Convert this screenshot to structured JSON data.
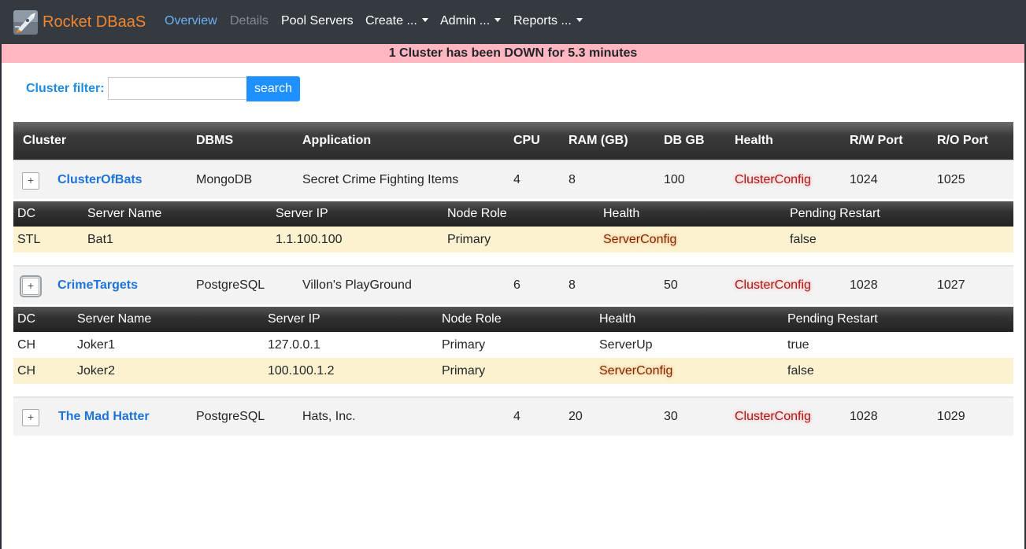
{
  "brand": {
    "name": "Rocket DBaaS",
    "logo_icon": "rocket-logo-icon"
  },
  "nav": {
    "overview": "Overview",
    "details": "Details",
    "pool_servers": "Pool Servers",
    "create": "Create ...",
    "admin": "Admin ...",
    "reports": "Reports ..."
  },
  "alert": {
    "text": "1 Cluster has been DOWN for 5.3 minutes"
  },
  "filter": {
    "label": "Cluster filter:",
    "value": "",
    "placeholder": "",
    "button": "search"
  },
  "table": {
    "headers": {
      "cluster": "Cluster",
      "dbms": "DBMS",
      "application": "Application",
      "cpu": "CPU",
      "ram": "RAM (GB)",
      "db_gb": "DB GB",
      "health": "Health",
      "rw_port": "R/W Port",
      "ro_port": "R/O Port"
    },
    "server_headers": {
      "dc": "DC",
      "server_name": "Server Name",
      "server_ip": "Server IP",
      "node_role": "Node Role",
      "health": "Health",
      "pending_restart": "Pending Restart"
    },
    "clusters": [
      {
        "expand": "+",
        "name": "ClusterOfBats",
        "dbms": "MongoDB",
        "application": "Secret Crime Fighting Items",
        "cpu": "4",
        "ram": "8",
        "db_gb": "100",
        "health": "ClusterConfig",
        "rw_port": "1024",
        "ro_port": "1025",
        "servers": [
          {
            "dc": "STL",
            "server_name": "Bat1",
            "server_ip": "1.1.100.100",
            "node_role": "Primary",
            "health": "ServerConfig",
            "pending_restart": "false"
          }
        ]
      },
      {
        "expand": "+",
        "name": "CrimeTargets",
        "dbms": "PostgreSQL",
        "application": "Villon's PlayGround",
        "cpu": "6",
        "ram": "8",
        "db_gb": "50",
        "health": "ClusterConfig",
        "rw_port": "1028",
        "ro_port": "1027",
        "servers": [
          {
            "dc": "CH",
            "server_name": "Joker1",
            "server_ip": "127.0.0.1",
            "node_role": "Primary",
            "health": "ServerUp",
            "pending_restart": "true"
          },
          {
            "dc": "CH",
            "server_name": "Joker2",
            "server_ip": "100.100.1.2",
            "node_role": "Primary",
            "health": "ServerConfig",
            "pending_restart": "false"
          }
        ]
      },
      {
        "expand": "+",
        "name": "The Mad Hatter",
        "dbms": "PostgreSQL",
        "application": "Hats, Inc.",
        "cpu": "4",
        "ram": "20",
        "db_gb": "30",
        "health": "ClusterConfig",
        "rw_port": "1028",
        "ro_port": "1029",
        "servers": []
      }
    ]
  },
  "colors": {
    "navbar_bg": "#343a40",
    "brand": "#f0862f",
    "nav_active": "#6ab3f7",
    "alert_bg": "#ffb6c1",
    "accent": "#1e90ff",
    "cluster_name": "#1d74d8",
    "warning_row": "#fcf2cf"
  }
}
